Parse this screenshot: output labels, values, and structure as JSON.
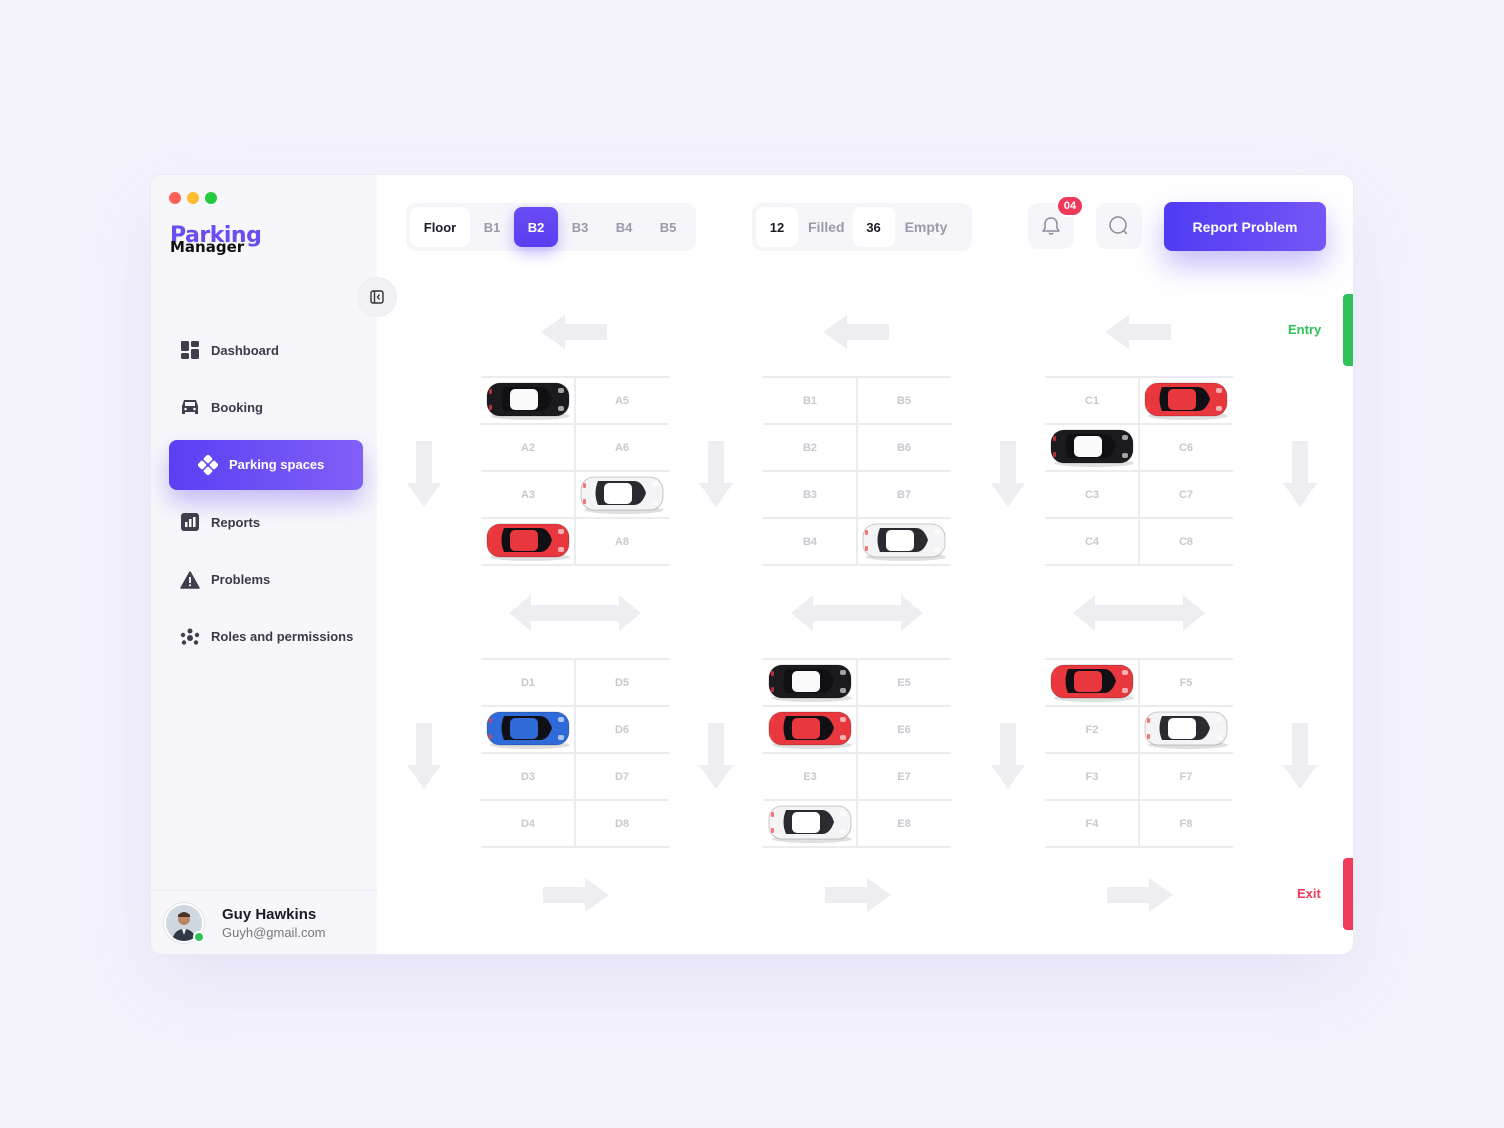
{
  "app": {
    "logo_line1": "Parking",
    "logo_line2": "Manager",
    "traffic_colors": [
      "#ff5f56",
      "#ffbd2e",
      "#27c93f"
    ]
  },
  "sidebar": {
    "items": [
      {
        "label": "Dashboard",
        "icon": "dashboard-icon",
        "active": false
      },
      {
        "label": "Booking",
        "icon": "car-icon",
        "active": false
      },
      {
        "label": "Parking spaces",
        "icon": "parking-spaces-icon",
        "active": true
      },
      {
        "label": "Reports",
        "icon": "reports-icon",
        "active": false
      },
      {
        "label": "Problems",
        "icon": "warning-icon",
        "active": false
      },
      {
        "label": "Roles and permissions",
        "icon": "roles-icon",
        "active": false
      }
    ]
  },
  "user": {
    "name": "Guy Hawkins",
    "email": "Guyh@gmail.com",
    "status_color": "#2fc25b"
  },
  "header": {
    "floor_label": "Floor",
    "floors": [
      "B1",
      "B2",
      "B3",
      "B4",
      "B5"
    ],
    "selected_floor": "B2",
    "filled_count": "12",
    "filled_label": "Filled",
    "empty_count": "36",
    "empty_label": "Empty",
    "notification_badge": "04",
    "report_button": "Report Problem"
  },
  "map": {
    "entry_label": "Entry",
    "exit_label": "Exit",
    "entry_color": "#2fc25b",
    "exit_color": "#f03a5a",
    "blocks": [
      {
        "id": "A",
        "slots": [
          "",
          "A5",
          "A2",
          "A6",
          "A3",
          "",
          "",
          "A8"
        ],
        "cars": [
          {
            "slot": 0,
            "color": "black"
          },
          {
            "slot": 5,
            "color": "white"
          },
          {
            "slot": 6,
            "color": "red"
          }
        ]
      },
      {
        "id": "B",
        "slots": [
          "B1",
          "B5",
          "B2",
          "B6",
          "B3",
          "B7",
          "B4",
          ""
        ],
        "cars": [
          {
            "slot": 7,
            "color": "white"
          }
        ]
      },
      {
        "id": "C",
        "slots": [
          "C1",
          "",
          "",
          "C6",
          "C3",
          "C7",
          "C4",
          "C8"
        ],
        "cars": [
          {
            "slot": 1,
            "color": "red"
          },
          {
            "slot": 2,
            "color": "black"
          }
        ]
      },
      {
        "id": "D",
        "slots": [
          "D1",
          "D5",
          "",
          "D6",
          "D3",
          "D7",
          "D4",
          "D8"
        ],
        "cars": [
          {
            "slot": 2,
            "color": "blue"
          }
        ]
      },
      {
        "id": "E",
        "slots": [
          "",
          "E5",
          "",
          "E6",
          "E3",
          "E7",
          "",
          "E8"
        ],
        "cars": [
          {
            "slot": 0,
            "color": "black"
          },
          {
            "slot": 2,
            "color": "red"
          },
          {
            "slot": 6,
            "color": "white"
          }
        ]
      },
      {
        "id": "F",
        "slots": [
          "",
          "F5",
          "F2",
          "",
          "F3",
          "F7",
          "F4",
          "F8"
        ],
        "cars": [
          {
            "slot": 0,
            "color": "red"
          },
          {
            "slot": 3,
            "color": "white"
          }
        ]
      }
    ],
    "car_colors": {
      "black": "#1a1a1f",
      "white": "#f4f4f6",
      "red": "#e8383d",
      "blue": "#2f6bd8"
    }
  }
}
